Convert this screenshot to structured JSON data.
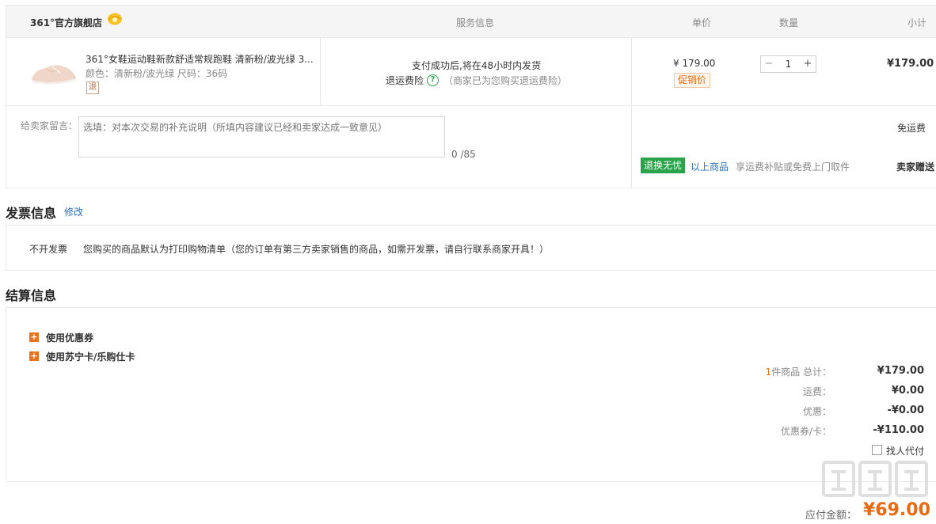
{
  "order": {
    "shop_name": "361°官方旗舰店",
    "headers": {
      "service": "服务信息",
      "unit_price": "单价",
      "quantity": "数量",
      "subtotal": "小计"
    },
    "item": {
      "title": "361°女鞋运动鞋新款舒适常规跑鞋 清新粉/波光绿 3...",
      "attributes": "颜色：清新粉/波光绿   尺码：36码",
      "refund_tag": "退",
      "service_line1": "支付成功后,将在48小时内发货",
      "insurance_label": "退运费险",
      "insurance_icon": "?",
      "insurance_note": "（商家已为您购买退运费险）",
      "unit_price": "¥ 179.00",
      "promo_tag": "促销价",
      "qty_minus": "−",
      "qty_value": "1",
      "qty_plus": "+",
      "subtotal": "¥179.00"
    },
    "message": {
      "label": "给卖家留言：",
      "placeholder": "选填：对本次交易的补充说明（所填内容建议已经和卖家达成一致意见）",
      "counter": "0 /85"
    },
    "shipping": {
      "free_shipping": "免运费",
      "worry_badge": "退换无忧",
      "worry_link": "以上商品",
      "worry_text": "享运费补贴或免费上门取件",
      "seller_gift": "卖家赠送"
    }
  },
  "invoice": {
    "title": "发票信息",
    "edit_label": "修改",
    "type": "不开发票",
    "text": "您购买的商品默认为打印购物清单（您的订单有第三方卖家销售的商品，如需开发票，请自行联系商家开具！）"
  },
  "settlement": {
    "title": "结算信息",
    "options": [
      {
        "icon": "+",
        "label": "使用优惠券"
      },
      {
        "icon": "+",
        "label": "使用苏宁卡/乐购仕卡"
      }
    ],
    "summary": {
      "count": "1",
      "count_label": "件商品 总计：",
      "total": "¥179.00",
      "shipping_label": "运费：",
      "shipping": "¥0.00",
      "discount_label": "优惠：",
      "discount": "-¥0.00",
      "coupon_label": "优惠券/卡：",
      "coupon": "-¥110.00"
    },
    "proxy_label": "找人代付",
    "pay_label": "应付金额：",
    "pay_total": "¥69.00"
  },
  "colors": {
    "accent": "#e86a12",
    "green": "#2aa34a",
    "link": "#2a6fb8"
  }
}
